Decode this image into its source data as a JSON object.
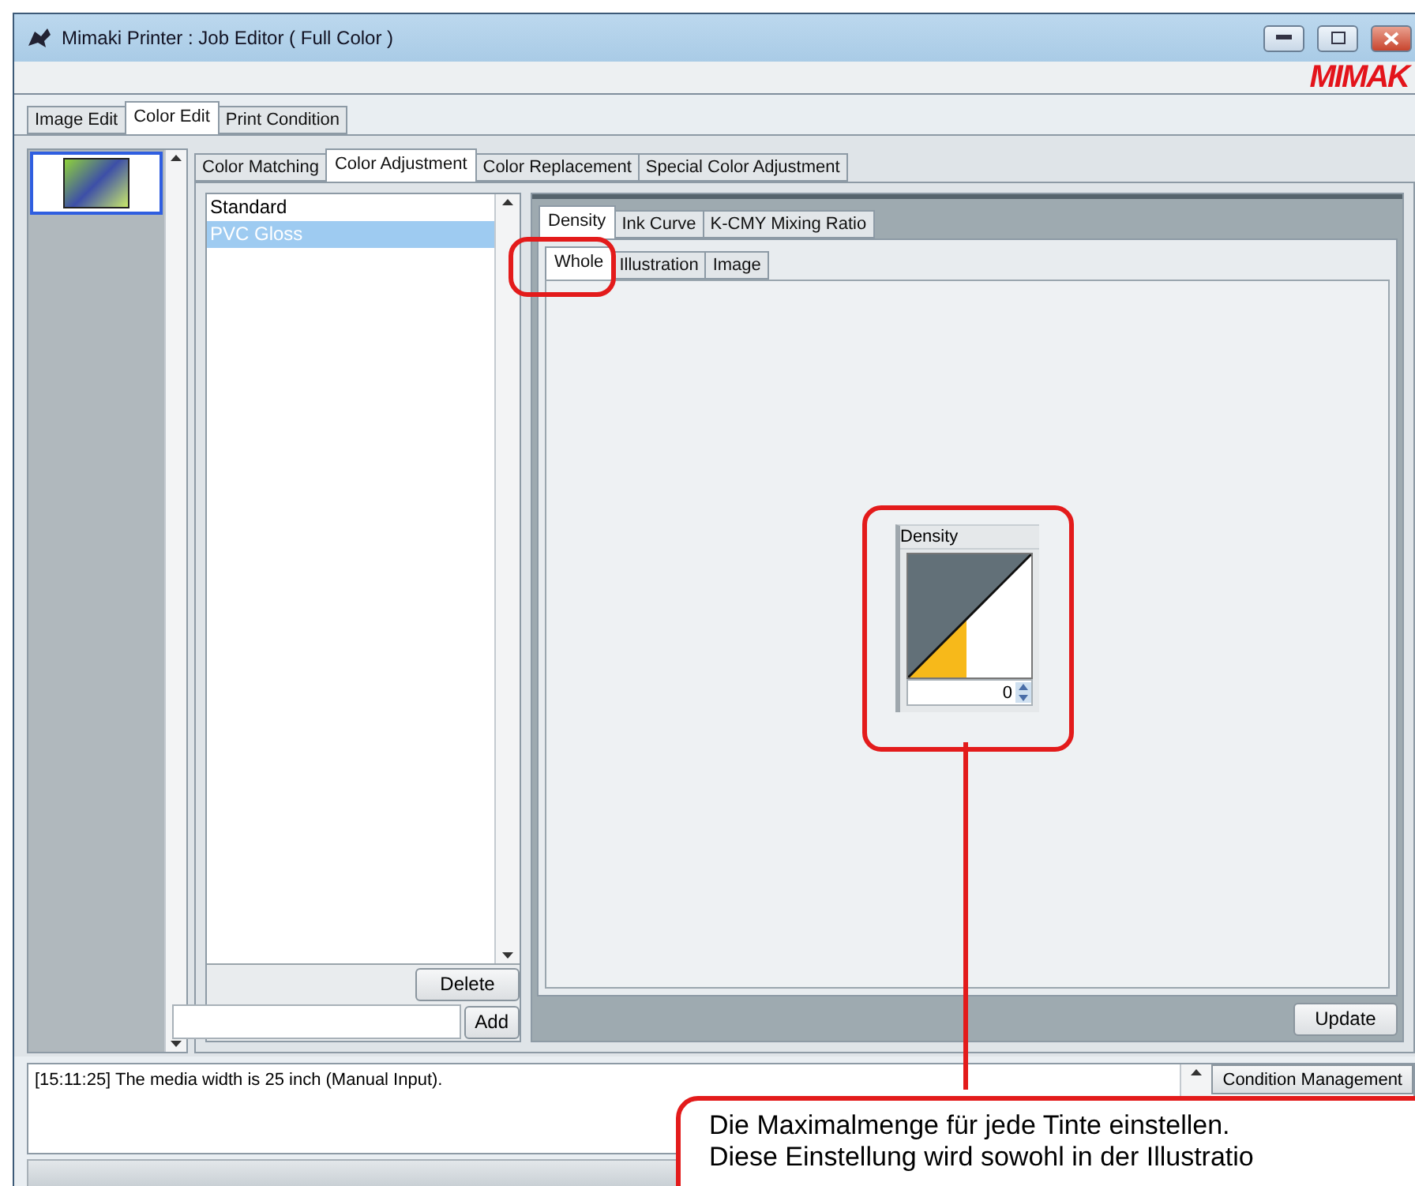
{
  "window": {
    "title": "Mimaki Printer : Job Editor ( Full Color )",
    "logo": "MIMAK"
  },
  "main_tabs": [
    {
      "label": "Image Edit",
      "selected": false
    },
    {
      "label": "Color Edit",
      "selected": true
    },
    {
      "label": "Print Condition",
      "selected": false
    }
  ],
  "thumbnails": [
    {
      "selected": true
    }
  ],
  "sub_tabs": [
    {
      "label": "Color Matching",
      "selected": false
    },
    {
      "label": "Color Adjustment",
      "selected": true
    },
    {
      "label": "Color Replacement",
      "selected": false
    },
    {
      "label": "Special Color Adjustment",
      "selected": false
    }
  ],
  "adjustment_list": {
    "items": [
      {
        "label": "Standard",
        "selected": false
      },
      {
        "label": "PVC Gloss",
        "selected": true
      }
    ],
    "delete_button": "Delete",
    "add_button": "Add"
  },
  "density_tabs": [
    {
      "label": "Density",
      "selected": true
    },
    {
      "label": "Ink Curve",
      "selected": false
    },
    {
      "label": "K-CMY Mixing Ratio",
      "selected": false
    }
  ],
  "scope_tabs": [
    {
      "label": "Whole",
      "selected": true
    },
    {
      "label": "Illustration",
      "selected": false
    },
    {
      "label": "Image",
      "selected": false
    }
  ],
  "density_control": {
    "title": "Density",
    "value": "0"
  },
  "update_button": "Update",
  "log": {
    "message": "[15:11:25] The media width is 25 inch (Manual Input)."
  },
  "condition_button": "Condition Management",
  "callout": {
    "lines": [
      "Die Maximalmenge für jede Tinte einstellen.",
      "Diese Einstellung wird sowohl in der Illustratio"
    ]
  }
}
